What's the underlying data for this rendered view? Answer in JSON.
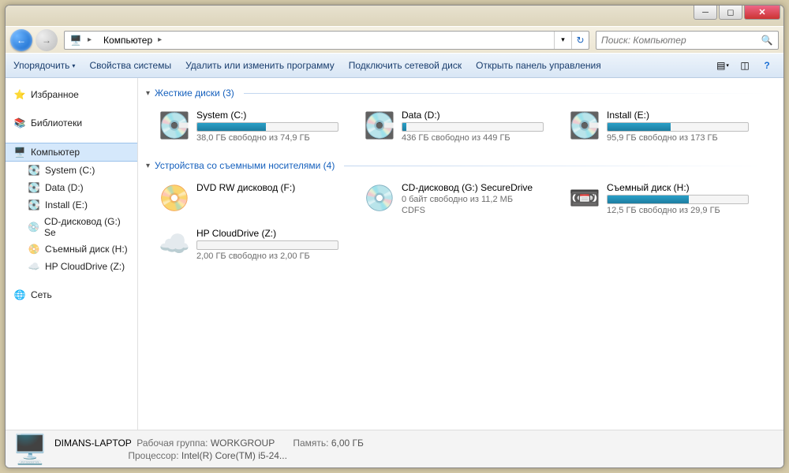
{
  "breadcrumb": {
    "root_icon": "computer",
    "item": "Компьютер"
  },
  "search": {
    "placeholder": "Поиск: Компьютер"
  },
  "toolbar": {
    "organize": "Упорядочить",
    "sysprops": "Свойства системы",
    "uninstall": "Удалить или изменить программу",
    "mapdrive": "Подключить сетевой диск",
    "cpanel": "Открыть панель управления"
  },
  "sidebar": {
    "favorites": "Избранное",
    "libraries": "Библиотеки",
    "computer": "Компьютер",
    "network": "Сеть",
    "drives": [
      {
        "label": "System (C:)"
      },
      {
        "label": "Data (D:)"
      },
      {
        "label": "Install (E:)"
      },
      {
        "label": "CD-дисковод (G:) Se"
      },
      {
        "label": "Съемный диск (H:)"
      },
      {
        "label": "HP CloudDrive (Z:)"
      }
    ]
  },
  "groups": {
    "hdd": {
      "title": "Жесткие диски (3)"
    },
    "removable": {
      "title": "Устройства со съемными носителями (4)"
    }
  },
  "drives": {
    "c": {
      "name": "System (C:)",
      "free": "38,0 ГБ свободно из 74,9 ГБ",
      "pct": 49
    },
    "d": {
      "name": "Data (D:)",
      "free": "436 ГБ свободно из 449 ГБ",
      "pct": 3
    },
    "e": {
      "name": "Install (E:)",
      "free": "95,9 ГБ свободно из 173 ГБ",
      "pct": 45
    },
    "f": {
      "name": "DVD RW дисковод (F:)"
    },
    "g": {
      "name": "CD-дисковод (G:) SecureDrive",
      "free": "0 байт свободно из 11,2 МБ",
      "fs": "CDFS"
    },
    "h": {
      "name": "Съемный диск (H:)",
      "free": "12,5 ГБ свободно из 29,9 ГБ",
      "pct": 58
    },
    "z": {
      "name": "HP CloudDrive (Z:)",
      "free": "2,00 ГБ свободно из 2,00 ГБ",
      "pct": 0
    }
  },
  "status": {
    "computer_name": "DIMANS-LAPTOP",
    "workgroup_label": "Рабочая группа:",
    "workgroup": "WORKGROUP",
    "cpu_label": "Процессор:",
    "cpu": "Intel(R) Core(TM) i5-24...",
    "mem_label": "Память:",
    "mem": "6,00 ГБ"
  }
}
